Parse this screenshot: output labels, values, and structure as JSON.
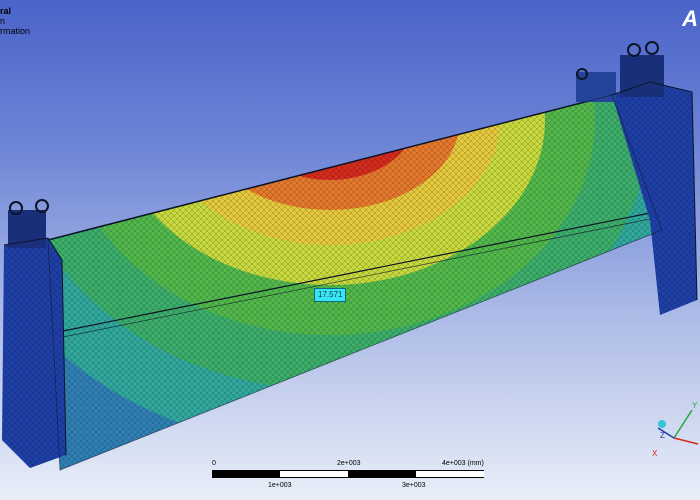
{
  "header": {
    "lines": [
      "ral",
      "n",
      "rmation"
    ],
    "brand": "A"
  },
  "probe": {
    "value": "17.571"
  },
  "scale": {
    "top_labels": [
      "0",
      "2e+003",
      "4e+003 (mm)"
    ],
    "bottom_labels": [
      "1e+003",
      "3e+003"
    ]
  },
  "triad": {
    "x": "X",
    "y": "Y",
    "z": "Z"
  },
  "colors": {
    "max": "#d42a1c",
    "high": "#e5782a",
    "mid_high": "#e6c93a",
    "mid": "#c8d93c",
    "mid_low": "#52b84a",
    "low": "#30a89c",
    "lower": "#2f7fb5",
    "min": "#1e3fa6"
  }
}
